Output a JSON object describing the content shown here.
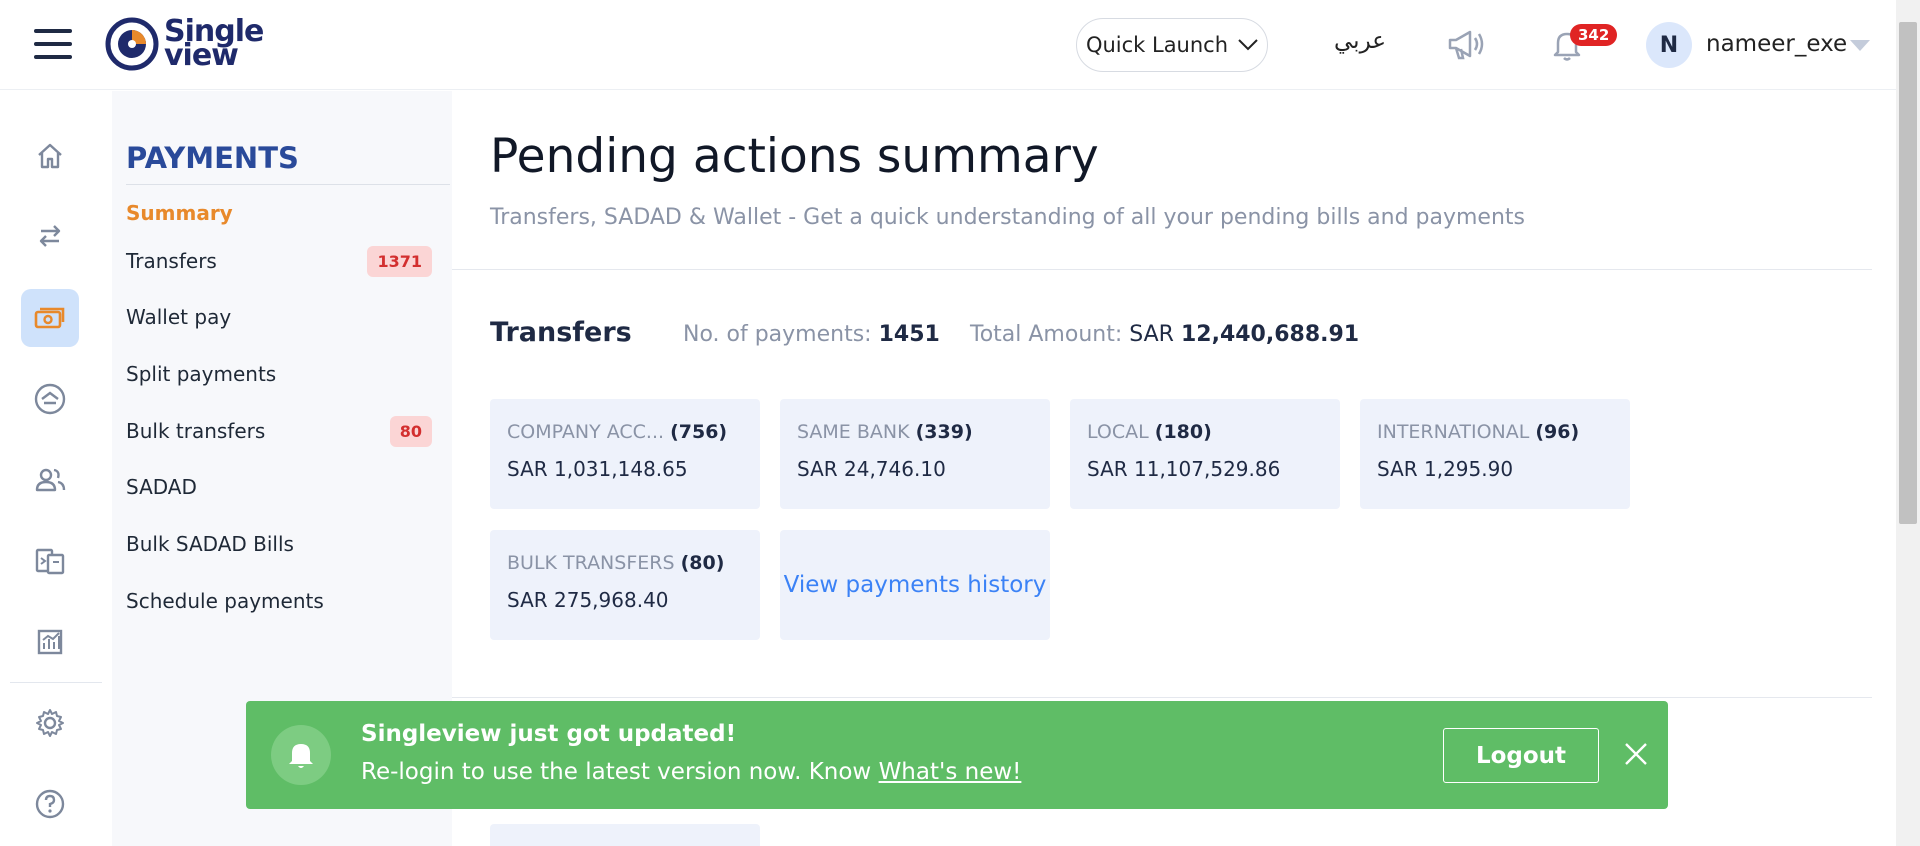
{
  "header": {
    "logo_line1": "Single",
    "logo_line2": "view",
    "quick_launch_label": "Quick Launch",
    "language_label": "عربي",
    "notifications_count": "342",
    "avatar_initial": "N",
    "username": "nameer_exe"
  },
  "iconbar": {
    "items": [
      "home-icon",
      "transfer-arrows-icon",
      "payments-icon",
      "deposit-icon",
      "users-icon",
      "documents-icon",
      "reports-icon",
      "settings-icon",
      "help-icon"
    ],
    "active": "payments-icon"
  },
  "subnav": {
    "title": "PAYMENTS",
    "items": [
      {
        "label": "Summary",
        "badge": ""
      },
      {
        "label": "Transfers",
        "badge": "1371"
      },
      {
        "label": "Wallet pay",
        "badge": ""
      },
      {
        "label": "Split payments",
        "badge": ""
      },
      {
        "label": "Bulk transfers",
        "badge": "80"
      },
      {
        "label": "SADAD",
        "badge": ""
      },
      {
        "label": "Bulk SADAD Bills",
        "badge": ""
      },
      {
        "label": "Schedule payments",
        "badge": ""
      }
    ]
  },
  "main": {
    "title": "Pending actions summary",
    "subtitle": "Transfers, SADAD & Wallet - Get a quick understanding of all your pending bills and payments",
    "transfers": {
      "section_title": "Transfers",
      "payments_label": "No. of payments:",
      "payments_value": "1451",
      "amount_label": "Total Amount:",
      "amount_currency": "SAR",
      "amount_value": "12,440,688.91",
      "cards": [
        {
          "name": "COMPANY ACC...",
          "count": "(756)",
          "amount": "SAR 1,031,148.65"
        },
        {
          "name": "SAME BANK",
          "count": "(339)",
          "amount": "SAR 24,746.10"
        },
        {
          "name": "LOCAL",
          "count": "(180)",
          "amount": "SAR 11,107,529.86"
        },
        {
          "name": "INTERNATIONAL",
          "count": "(96)",
          "amount": "SAR 1,295.90"
        },
        {
          "name": "BULK TRANSFERS",
          "count": "(80)",
          "amount": "SAR 275,968.40"
        }
      ],
      "history_link": "View payments history"
    }
  },
  "toast": {
    "title": "Singleview just got updated!",
    "message": "Re-login to use the latest version now. Know",
    "link": "What's new!",
    "button": "Logout"
  },
  "colors": {
    "accent": "#e8892b",
    "brand": "#2a4a9a",
    "toast_bg": "#5fbd66",
    "badge_bg": "#fbd5d5",
    "badge_text": "#d32f2f",
    "card_bg": "#eef2fb"
  }
}
